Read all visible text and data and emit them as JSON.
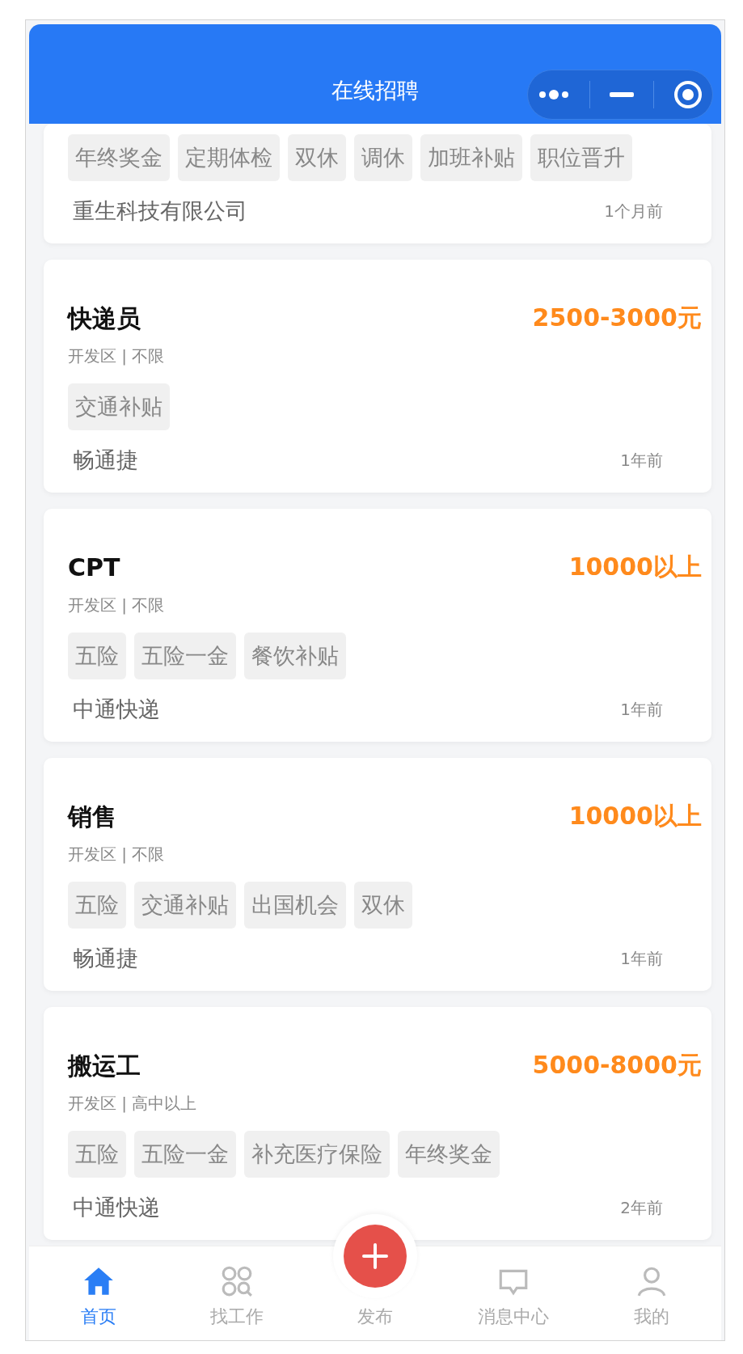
{
  "header": {
    "title": "在线招聘"
  },
  "jobs": [
    {
      "tags": [
        "年终奖金",
        "定期体检",
        "双休",
        "调休",
        "加班补贴",
        "职位晋升"
      ],
      "company": "重生科技有限公司",
      "time": "1个月前"
    },
    {
      "title": "快递员",
      "salary": "2500-3000元",
      "location": "开发区 | 不限",
      "tags": [
        "交通补贴"
      ],
      "company": "畅通捷",
      "time": "1年前"
    },
    {
      "title": "CPT",
      "salary": "10000以上",
      "location": "开发区 | 不限",
      "tags": [
        "五险",
        "五险一金",
        "餐饮补贴"
      ],
      "company": "中通快递",
      "time": "1年前"
    },
    {
      "title": "销售",
      "salary": "10000以上",
      "location": "开发区 | 不限",
      "tags": [
        "五险",
        "交通补贴",
        "出国机会",
        "双休"
      ],
      "company": "畅通捷",
      "time": "1年前"
    },
    {
      "title": "搬运工",
      "salary": "5000-8000元",
      "location": "开发区 | 高中以上",
      "tags": [
        "五险",
        "五险一金",
        "补充医疗保险",
        "年终奖金"
      ],
      "company": "中通快递",
      "time": "2年前"
    }
  ],
  "tab_bar": [
    {
      "kind": "home",
      "label": "首页",
      "selected": true
    },
    {
      "kind": "find",
      "label": "找工作",
      "selected": false
    },
    {
      "kind": "publish",
      "label": "发布",
      "selected": false
    },
    {
      "kind": "message",
      "label": "消息中心",
      "selected": false
    },
    {
      "kind": "me",
      "label": "我的",
      "selected": false
    }
  ]
}
